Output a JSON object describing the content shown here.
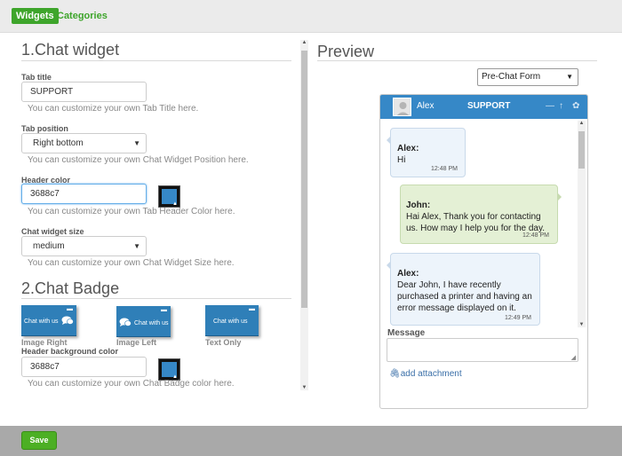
{
  "nav": {
    "tabs": [
      {
        "label": "Widgets",
        "active": true
      },
      {
        "label": "Categories",
        "active": false
      }
    ]
  },
  "chat_widget": {
    "heading": "1.Chat widget",
    "tab_title": {
      "label": "Tab title",
      "value": "SUPPORT",
      "hint": "You can customize your own Tab Title here."
    },
    "tab_position": {
      "label": "Tab position",
      "value": "Right bottom",
      "hint": "You can customize your own Chat Widget Position here."
    },
    "header_color": {
      "label": "Header color",
      "value": "3688c7",
      "hint": "You can customize your own Tab Header Color here.",
      "swatch": "#3688c7"
    },
    "widget_size": {
      "label": "Chat widget size",
      "value": "medium",
      "hint": "You can customize your own Chat Widget Size here."
    }
  },
  "chat_badge": {
    "heading": "2.Chat Badge",
    "options": [
      {
        "badge_text": "Chat with us",
        "caption": "Image Right"
      },
      {
        "badge_text": "Chat with us",
        "caption": "Image Left"
      },
      {
        "badge_text": "Chat with us",
        "caption": "Text Only"
      }
    ],
    "bg_color": {
      "label": "Header background color",
      "value": "3688c7",
      "hint": "You can customize your own Chat Badge color here.",
      "swatch": "#3688c7"
    }
  },
  "preview": {
    "heading": "Preview",
    "mode_select": "Pre-Chat Form",
    "header": {
      "agent": "Alex",
      "title": "SUPPORT",
      "color": "#3688c7"
    },
    "messages": [
      {
        "from": "agent",
        "name": "Alex:",
        "lines": [
          "Hi"
        ],
        "time": "12:48 PM"
      },
      {
        "from": "user",
        "name": "John:",
        "lines": [
          "Hai Alex, Thank you for contacting",
          "us. How may I help you for the day."
        ],
        "time": "12:48 PM"
      },
      {
        "from": "agent",
        "name": "Alex:",
        "lines": [
          "Dear John, I have recently",
          "purchased a printer and having an",
          "error message displayed on it."
        ],
        "time": "12:49 PM"
      }
    ],
    "message_label": "Message",
    "attachment_label": "add attachment"
  },
  "footer": {
    "save_label": "Save"
  },
  "colors": {
    "brand_green": "#3ea52b",
    "header_blue": "#3688c7",
    "user_bubble": "#e4f0d5",
    "agent_bubble": "#edf4fb"
  }
}
